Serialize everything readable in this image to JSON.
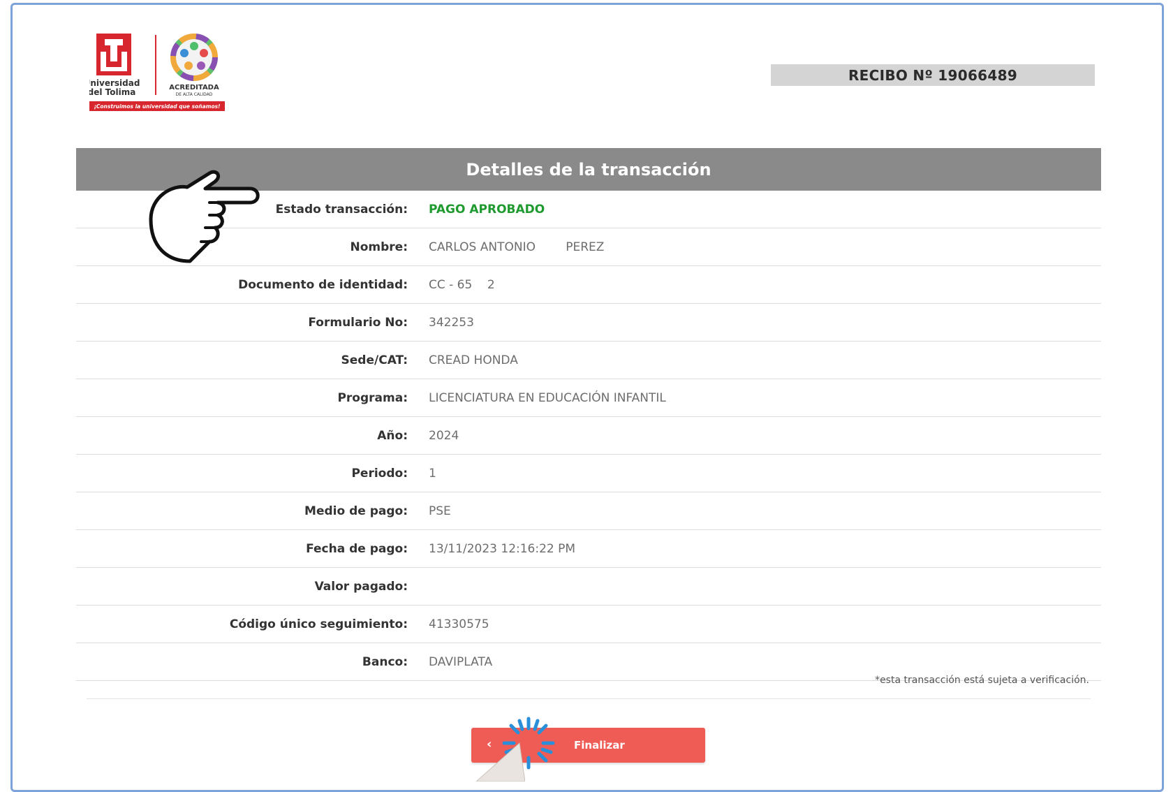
{
  "header": {
    "logo": {
      "institution_line1": "Universidad",
      "institution_line2": "del Tolima",
      "accreditation_line1": "ACREDITADA",
      "accreditation_line2": "DE ALTA CALIDAD",
      "slogan": "¡Construimos la universidad que soñamos!"
    },
    "receipt": "RECIBO Nº 19066489"
  },
  "table": {
    "title": "Detalles de la transacción",
    "rows": [
      {
        "label": "Estado transacción:",
        "value": "PAGO APROBADO"
      },
      {
        "label": "Nombre:",
        "value": "CARLOS ANTONIO        PEREZ"
      },
      {
        "label": "Documento de identidad:",
        "value": "CC - 65    2"
      },
      {
        "label": "Formulario No:",
        "value": "342253"
      },
      {
        "label": "Sede/CAT:",
        "value": "CREAD HONDA"
      },
      {
        "label": "Programa:",
        "value": "LICENCIATURA EN EDUCACIÓN INFANTIL"
      },
      {
        "label": "Año:",
        "value": "2024"
      },
      {
        "label": "Periodo:",
        "value": "1"
      },
      {
        "label": "Medio de pago:",
        "value": "PSE"
      },
      {
        "label": "Fecha de pago:",
        "value": "13/11/2023 12:16:22 PM"
      },
      {
        "label": "Valor pagado:",
        "value": ""
      },
      {
        "label": "Código único seguimiento:",
        "value": "41330575"
      },
      {
        "label": "Banco:",
        "value": "DAVIPLATA"
      }
    ]
  },
  "note": "*esta transacción está sujeta a verificación.",
  "actions": {
    "back_icon": "chevron-left-icon",
    "finish_label": "Finalizar"
  },
  "colors": {
    "header_bar": "#8a8a8a",
    "status_green": "#1f9a2f",
    "button_red": "#ef5b55",
    "frame_blue": "#7ea3d8",
    "logo_red": "#d7262d"
  }
}
